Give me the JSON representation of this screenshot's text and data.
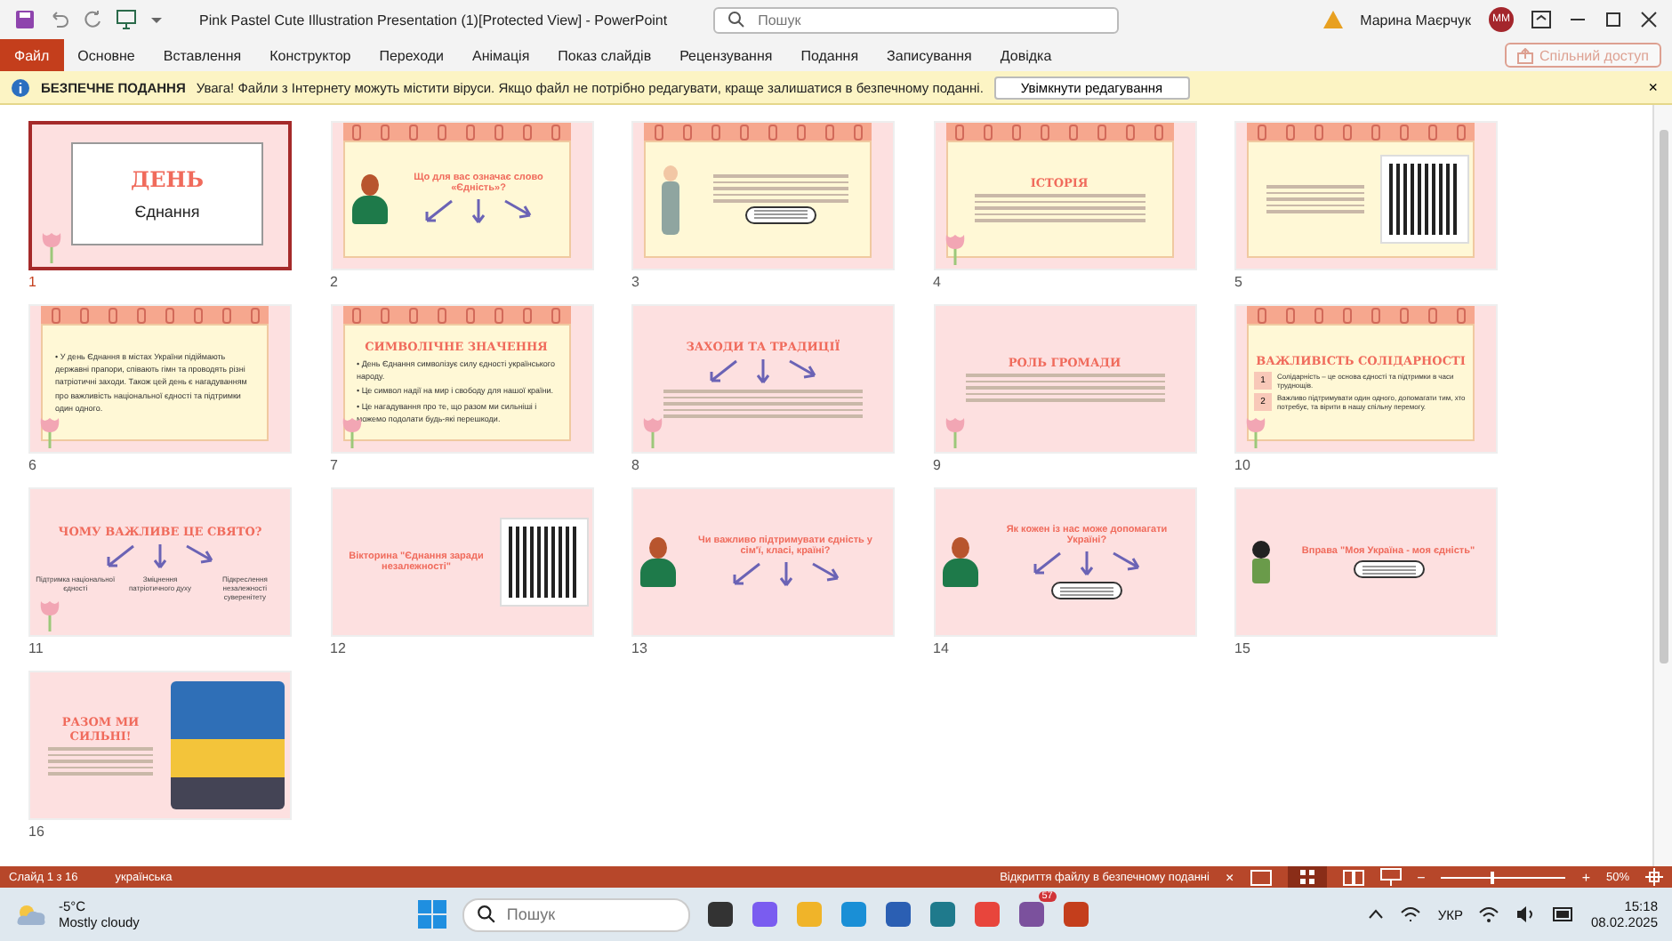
{
  "window": {
    "title": "Pink Pastel Cute Illustration Presentation (1)[Protected View]  -  PowerPoint",
    "search_placeholder": "Пошук",
    "user_name": "Марина Маєрчук",
    "user_initials": "ММ"
  },
  "ribbon_tabs": [
    {
      "label": "Файл",
      "selected": true
    },
    {
      "label": "Основне",
      "selected": false
    },
    {
      "label": "Вставлення",
      "selected": false
    },
    {
      "label": "Конструктор",
      "selected": false
    },
    {
      "label": "Переходи",
      "selected": false
    },
    {
      "label": "Анімація",
      "selected": false
    },
    {
      "label": "Показ слайдів",
      "selected": false
    },
    {
      "label": "Рецензування",
      "selected": false
    },
    {
      "label": "Подання",
      "selected": false
    },
    {
      "label": "Записування",
      "selected": false
    },
    {
      "label": "Довідка",
      "selected": false
    }
  ],
  "share_button": {
    "label": "Спільний доступ",
    "disabled": true
  },
  "message_bar": {
    "title": "БЕЗПЕЧНЕ ПОДАННЯ",
    "text": "Увага! Файли з Інтернету можуть містити віруси. Якщо файл не потрібно редагувати, краще залишатися в безпечному поданні.",
    "button": "Увімкнути редагування",
    "close": "×"
  },
  "slides": [
    {
      "number": "1",
      "selected": true,
      "kind": "cover",
      "title": "ДЕНЬ",
      "subtitle": "Єднання",
      "figure": {
        "kind": "tulips"
      }
    },
    {
      "number": "2",
      "selected": false,
      "kind": "calendar",
      "question": "Що для вас означає слово «Єдність»?",
      "figure": {
        "kind": "girl"
      },
      "arrows": true
    },
    {
      "number": "3",
      "selected": false,
      "kind": "calendar",
      "figure": {
        "kind": "man"
      },
      "bubble": true
    },
    {
      "number": "4",
      "selected": false,
      "kind": "calendar",
      "title": "ІСТОРІЯ",
      "figure": {
        "kind": "tulips"
      }
    },
    {
      "number": "5",
      "selected": false,
      "kind": "calendar",
      "figure": {
        "kind": "qr"
      }
    },
    {
      "number": "6",
      "selected": false,
      "kind": "calendar",
      "body": [
        "• У день Єднання в містах України підіймають державні прапори, співають гімн та проводять різні патріотичні заходи. Також цей день є нагадуванням про важливість національної єдності та підтримки один одного."
      ],
      "figure": {
        "kind": "tulips"
      }
    },
    {
      "number": "7",
      "selected": false,
      "kind": "calendar",
      "title": "СИМВОЛІЧНЕ ЗНАЧЕННЯ",
      "body": [
        "• День Єднання символізує силу єдності українського народу.",
        "• Це символ надії на мир і свободу для нашої країни.",
        "• Це нагадування про те, що разом ми сильніші і можемо подолати будь-які перешкоди."
      ],
      "figure": {
        "kind": "tulips"
      }
    },
    {
      "number": "8",
      "selected": false,
      "kind": "pink",
      "title": "ЗАХОДИ ТА ТРАДИЦІЇ",
      "figure": {
        "kind": "tulips"
      },
      "arrows": true
    },
    {
      "number": "9",
      "selected": false,
      "kind": "pink",
      "title": "РОЛЬ ГРОМАДИ",
      "figure": {
        "kind": "tulips"
      }
    },
    {
      "number": "10",
      "selected": false,
      "kind": "calendar",
      "title": "ВАЖЛИВІСТЬ СОЛІДАРНОСТІ",
      "points": [
        {
          "mark": "1",
          "text": "Солідарність – це основа єдності та підтримки в часи труднощів."
        },
        {
          "mark": "2",
          "text": "Важливо підтримувати один одного, допомагати тим, хто потребує, та вірити в нашу спільну перемогу."
        }
      ],
      "figure": {
        "kind": "tulips"
      }
    },
    {
      "number": "11",
      "selected": false,
      "kind": "pink",
      "title": "ЧОМУ ВАЖЛИВЕ ЦЕ СВЯТО?",
      "arrows": true,
      "labels": [
        "Підтримка національної єдності",
        "Зміцнення патріотичного духу",
        "Підкреслення незалежності суверенітету"
      ],
      "figure": {
        "kind": "tulips"
      }
    },
    {
      "number": "12",
      "selected": false,
      "kind": "pink",
      "question": "Вікторина \"Єднання заради незалежності\"",
      "figure": {
        "kind": "qr"
      }
    },
    {
      "number": "13",
      "selected": false,
      "kind": "pink",
      "question": "Чи важливо підтримувати єдність у сім'ї, класі, країні?",
      "figure": {
        "kind": "girl"
      },
      "arrows": true
    },
    {
      "number": "14",
      "selected": false,
      "kind": "pink",
      "question": "Як кожен із нас може допомагати Україні?",
      "figure": {
        "kind": "girl"
      },
      "arrows": true,
      "bubble": true
    },
    {
      "number": "15",
      "selected": false,
      "kind": "pink",
      "question": "Вправа \"Моя Україна - моя єдність\"",
      "figure": {
        "kind": "boy"
      },
      "bubble": true
    },
    {
      "number": "16",
      "selected": false,
      "kind": "pink",
      "title": "РАЗОМ МИ СИЛЬНІ!",
      "figure": {
        "kind": "flag"
      }
    }
  ],
  "status_bar": {
    "slide_info": "Слайд 1 з 16",
    "language": "українська",
    "notice": "Відкриття файлу в безпечному поданні",
    "close": "×",
    "zoom": {
      "level": 0.4
    },
    "zoom_text": "50%",
    "zoom_minus": "−",
    "zoom_plus": "+"
  },
  "taskbar": {
    "temperature": "-5°C",
    "weather": "Mostly cloudy",
    "search_placeholder": "Пошук",
    "badge": "57",
    "language": "УКР",
    "time": "15:18",
    "date": "08.02.2025"
  }
}
